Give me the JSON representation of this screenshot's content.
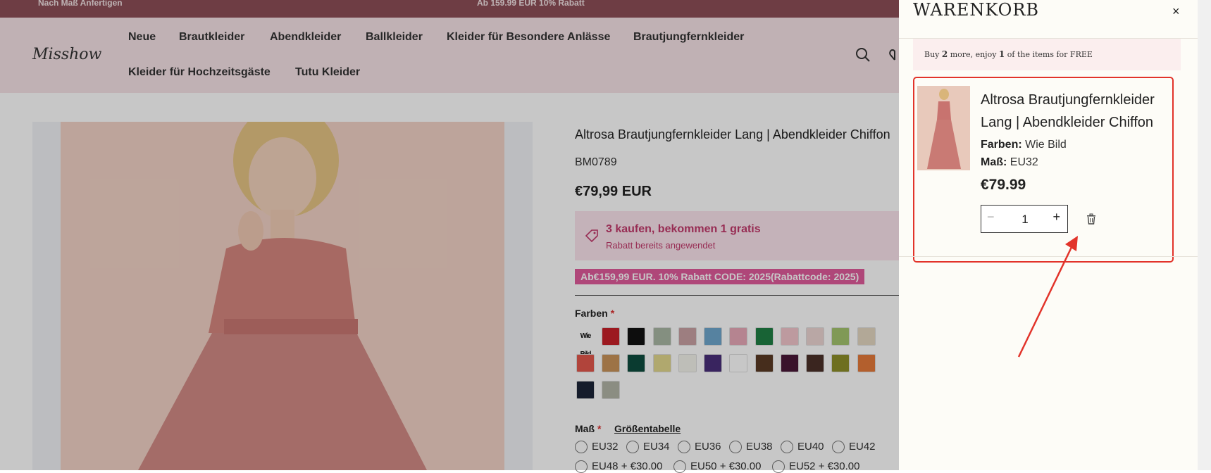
{
  "topbar": {
    "left_text": "Nach Maß Anfertigen",
    "center_text": "Ab 159.99 EUR 10% Rabatt"
  },
  "header": {
    "logo": "Misshow",
    "nav": [
      "Neue",
      "Brautkleider",
      "Abendkleider",
      "Ballkleider",
      "Kleider für Besondere Anlässe",
      "Brautjungfernkleider",
      "Kleider für Hochzeitsgäste",
      "Tutu Kleider"
    ],
    "icons": [
      "search-icon",
      "heart-icon"
    ]
  },
  "product": {
    "title": "Altrosa Brautjungfernkleider Lang | Abendkleider Chiffon",
    "sku": "BM0789",
    "price": "€79,99 EUR",
    "promo_title": "3 kaufen, bekommen 1 gratis",
    "promo_sub": "Rabatt bereits angewendet",
    "code_text": "Ab€159,99 EUR. 10% Rabatt CODE: 2025(Rabattcode: 2025)",
    "color_label": "Farben",
    "color_first": "Wie Bild",
    "swatch_colors": [
      "#c8202a",
      "#111111",
      "#a9b8a5",
      "#caa2a4",
      "#6fa7cd",
      "#e8a9b9",
      "#1f7f45",
      "#f2c6cc",
      "#eed7d4",
      "#a5c46f",
      "#e4d8c2",
      "#2a2f79",
      "#e3584c",
      "#c9945a",
      "#0e4c3e",
      "#e2d88d",
      "#f4f4ec",
      "#4a2f7a",
      "#ffffff",
      "#5a3a25",
      "#4a1838",
      "#4b3028",
      "#8d8f2a",
      "#e67a3a",
      "#177a7a",
      "#1c2438",
      "#b3b5a7"
    ],
    "size_label": "Maß",
    "size_guide": "Größentabelle",
    "sizes_row1": [
      "EU32",
      "EU34",
      "EU36",
      "EU38",
      "EU40",
      "EU42"
    ],
    "sizes_row2": [
      "EU48 + €30.00",
      "EU50 + €30.00",
      "EU52 + €30.00"
    ]
  },
  "cart": {
    "title": "WARENKORB",
    "close": "×",
    "banner_pre": "Buy",
    "banner_n": "2",
    "banner_mid": "more, enjoy",
    "banner_m": "1",
    "banner_post": "of the items for FREE",
    "item": {
      "name": "Altrosa Brautjungfernkleider Lang | Abendkleider Chiffon",
      "color_label": "Farben:",
      "color_value": "Wie Bild",
      "size_label": "Maß:",
      "size_value": "EU32",
      "price": "€79.99",
      "quantity": "1",
      "minus": "−",
      "plus": "+"
    }
  },
  "colors": {
    "highlight": "#e2332a",
    "topbar": "#8e4f58",
    "promo_text": "#c2396b",
    "code_bg": "#e05b9c"
  }
}
